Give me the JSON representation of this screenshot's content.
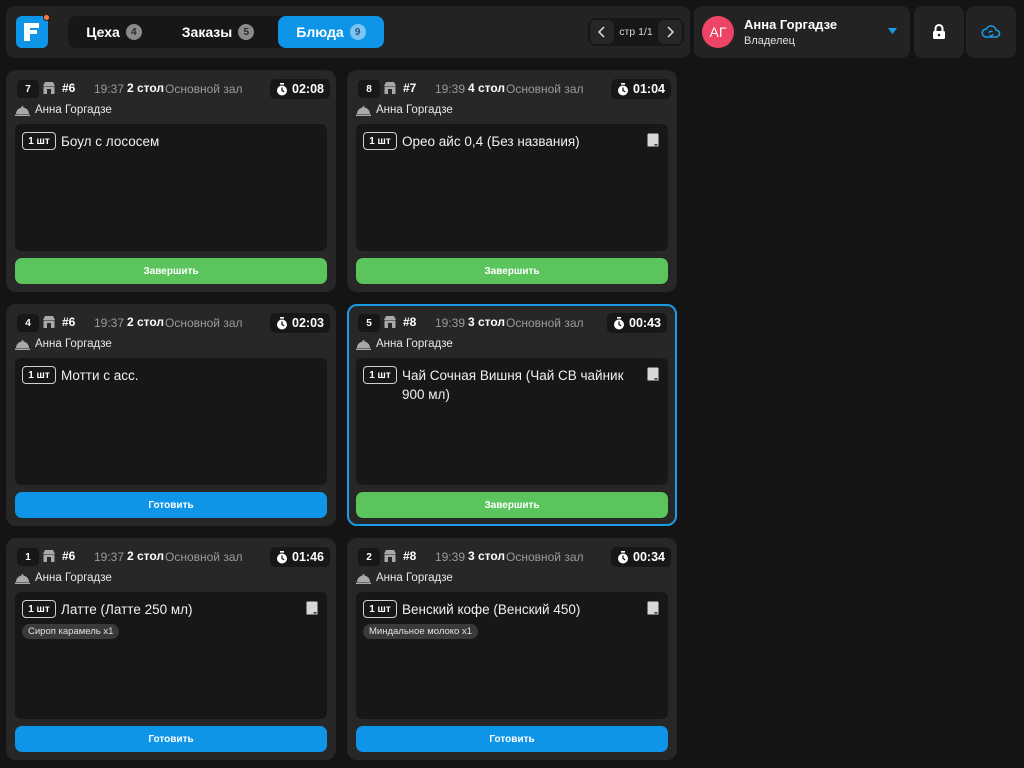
{
  "colors": {
    "accent": "#0f95e8",
    "finish_button": "#5cc45c",
    "cook_button": "#0f95e8",
    "avatar": "#ee4466",
    "selected_border": "#1a9be8"
  },
  "header": {
    "tabs": [
      {
        "label": "Цеха",
        "count": "4"
      },
      {
        "label": "Заказы",
        "count": "5"
      },
      {
        "label": "Блюда",
        "count": "9"
      }
    ],
    "active_tab": "Блюда",
    "pager": {
      "label": "стр 1/1",
      "prev_icon": "chevron-left-icon",
      "next_icon": "chevron-right-icon"
    },
    "user": {
      "initials": "АГ",
      "name": "Анна Горгадзе",
      "role": "Владелец"
    },
    "lock_icon": "lock-icon",
    "cloud_icon": "cloud-sync-icon"
  },
  "cards": [
    {
      "num": "7",
      "order": "#6",
      "time": "19:37",
      "table": "2 стол",
      "hall": "Основной зал",
      "timer": "02:08",
      "waiter": "Анна Горгадзе",
      "qty": "1 шт",
      "item": "Боул с лососем",
      "modifier": "",
      "note": false,
      "action": "Завершить",
      "action_type": "done",
      "selected": false
    },
    {
      "num": "8",
      "order": "#7",
      "time": "19:39",
      "table": "4 стол",
      "hall": "Основной зал",
      "timer": "01:04",
      "waiter": "Анна Горгадзе",
      "qty": "1 шт",
      "item": "Орео айс 0,4 (Без названия)",
      "modifier": "",
      "note": true,
      "action": "Завершить",
      "action_type": "done",
      "selected": false
    },
    {
      "num": "4",
      "order": "#6",
      "time": "19:37",
      "table": "2 стол",
      "hall": "Основной зал",
      "timer": "02:03",
      "waiter": "Анна Горгадзе",
      "qty": "1 шт",
      "item": "Мотти с асс.",
      "modifier": "",
      "note": false,
      "action": "Готовить",
      "action_type": "cook",
      "selected": false
    },
    {
      "num": "5",
      "order": "#8",
      "time": "19:39",
      "table": "3 стол",
      "hall": "Основной зал",
      "timer": "00:43",
      "waiter": "Анна Горгадзе",
      "qty": "1 шт",
      "item": "Чай Сочная Вишня (Чай СВ чайник 900 мл)",
      "modifier": "",
      "note": true,
      "action": "Завершить",
      "action_type": "done",
      "selected": true
    },
    {
      "num": "1",
      "order": "#6",
      "time": "19:37",
      "table": "2 стол",
      "hall": "Основной зал",
      "timer": "01:46",
      "waiter": "Анна Горгадзе",
      "qty": "1 шт",
      "item": "Латте (Латте 250 мл)",
      "modifier": "Сироп карамель x1",
      "note": true,
      "action": "Готовить",
      "action_type": "cook",
      "selected": false
    },
    {
      "num": "2",
      "order": "#8",
      "time": "19:39",
      "table": "3 стол",
      "hall": "Основной зал",
      "timer": "00:34",
      "waiter": "Анна Горгадзе",
      "qty": "1 шт",
      "item": "Венский кофе (Венский 450)",
      "modifier": "Миндальное молоко x1",
      "note": true,
      "action": "Готовить",
      "action_type": "cook",
      "selected": false
    }
  ]
}
